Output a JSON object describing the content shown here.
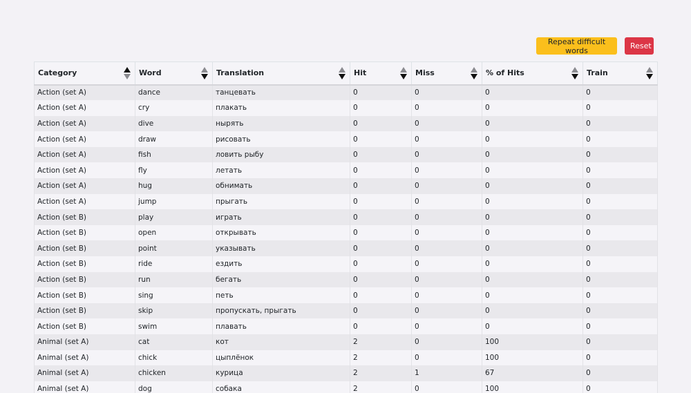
{
  "toolbar": {
    "repeat_label": "Repeat difficult words",
    "reset_label": "Reset"
  },
  "colors": {
    "repeat_button": "#fbbf1c",
    "reset_button": "#dc3646",
    "page_background": "#f3f2f6"
  },
  "table": {
    "headers": [
      "Category",
      "Word",
      "Translation",
      "Hit",
      "Miss",
      "% of Hits",
      "Train"
    ],
    "sort_icons": [
      "sort-icon",
      "sort-icon",
      "sort-icon",
      "sort-icon",
      "sort-icon",
      "sort-icon",
      "sort-icon"
    ],
    "rows": [
      [
        "Action (set A)",
        "dance",
        "танцевать",
        "0",
        "0",
        "0",
        "0"
      ],
      [
        "Action (set A)",
        "cry",
        "плакать",
        "0",
        "0",
        "0",
        "0"
      ],
      [
        "Action (set A)",
        "dive",
        "нырять",
        "0",
        "0",
        "0",
        "0"
      ],
      [
        "Action (set A)",
        "draw",
        "рисовать",
        "0",
        "0",
        "0",
        "0"
      ],
      [
        "Action (set A)",
        "fish",
        "ловить рыбу",
        "0",
        "0",
        "0",
        "0"
      ],
      [
        "Action (set A)",
        "fly",
        "летать",
        "0",
        "0",
        "0",
        "0"
      ],
      [
        "Action (set A)",
        "hug",
        "обнимать",
        "0",
        "0",
        "0",
        "0"
      ],
      [
        "Action (set A)",
        "jump",
        "прыгать",
        "0",
        "0",
        "0",
        "0"
      ],
      [
        "Action (set B)",
        "play",
        "играть",
        "0",
        "0",
        "0",
        "0"
      ],
      [
        "Action (set B)",
        "open",
        "открывать",
        "0",
        "0",
        "0",
        "0"
      ],
      [
        "Action (set B)",
        "point",
        "указывать",
        "0",
        "0",
        "0",
        "0"
      ],
      [
        "Action (set B)",
        "ride",
        "ездить",
        "0",
        "0",
        "0",
        "0"
      ],
      [
        "Action (set B)",
        "run",
        "бегать",
        "0",
        "0",
        "0",
        "0"
      ],
      [
        "Action (set B)",
        "sing",
        "петь",
        "0",
        "0",
        "0",
        "0"
      ],
      [
        "Action (set B)",
        "skip",
        "пропускать, прыгать",
        "0",
        "0",
        "0",
        "0"
      ],
      [
        "Action (set B)",
        "swim",
        "плавать",
        "0",
        "0",
        "0",
        "0"
      ],
      [
        "Animal (set A)",
        "cat",
        "кот",
        "2",
        "0",
        "100",
        "0"
      ],
      [
        "Animal (set A)",
        "chick",
        "цыплёнок",
        "2",
        "0",
        "100",
        "0"
      ],
      [
        "Animal (set A)",
        "chicken",
        "курица",
        "2",
        "1",
        "67",
        "0"
      ],
      [
        "Animal (set A)",
        "dog",
        "собака",
        "2",
        "0",
        "100",
        "0"
      ]
    ]
  }
}
